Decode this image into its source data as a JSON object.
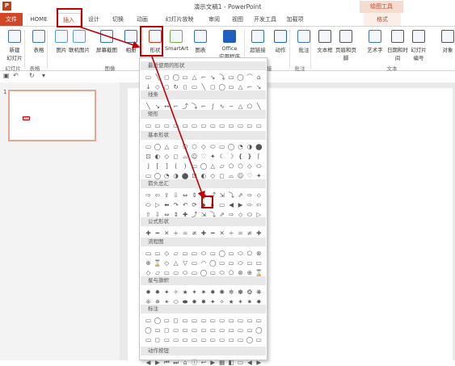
{
  "window": {
    "title": "演示文稿1 - PowerPoint",
    "context_tab_group": "绘图工具",
    "app_icon": "P"
  },
  "tabs": [
    "文件",
    "HOME",
    "插入",
    "设计",
    "切换",
    "动画",
    "幻灯片放映",
    "审阅",
    "视图",
    "开发工具",
    "加载项",
    "格式"
  ],
  "ribbon": {
    "buttons": [
      {
        "label": "新建\n幻灯片",
        "icon": "new-slide-icon"
      },
      {
        "label": "表格",
        "icon": "table-icon"
      },
      {
        "label": "图片",
        "icon": "picture-icon"
      },
      {
        "label": "联机图片",
        "icon": "online-picture-icon"
      },
      {
        "label": "屏幕截图",
        "icon": "screenshot-icon"
      },
      {
        "label": "相册",
        "icon": "album-icon"
      },
      {
        "label": "形状",
        "icon": "shapes-icon"
      },
      {
        "label": "SmartArt",
        "icon": "smartart-icon"
      },
      {
        "label": "图表",
        "icon": "chart-icon"
      },
      {
        "label": "Office\n应用程序",
        "icon": "office-store-icon"
      },
      {
        "label": "超链接",
        "icon": "hyperlink-icon"
      },
      {
        "label": "动作",
        "icon": "action-icon"
      },
      {
        "label": "批注",
        "icon": "comment-icon"
      },
      {
        "label": "文本框",
        "icon": "textbox-icon"
      },
      {
        "label": "页眉和页脚",
        "icon": "header-footer-icon"
      },
      {
        "label": "艺术字",
        "icon": "wordart-icon"
      },
      {
        "label": "日期和时间",
        "icon": "datetime-icon"
      },
      {
        "label": "幻灯片\n编号",
        "icon": "slide-number-icon"
      },
      {
        "label": "对象",
        "icon": "object-icon"
      }
    ],
    "groups": [
      "幻灯片",
      "表格",
      "图像",
      "链接",
      "批注",
      "文本"
    ]
  },
  "quick_access": [
    "save-icon",
    "undo-icon",
    "redo-icon",
    "customize-icon"
  ],
  "thumbnails": {
    "slide_number": "1"
  },
  "gallery": {
    "sections": [
      "最近使用的形状",
      "线条",
      "矩形",
      "基本形状",
      "箭头总汇",
      "公式形状",
      "流程图",
      "星与旗帜",
      "标注",
      "动作按钮"
    ],
    "glyphs": {
      "recent": "▭╲◻◯▭△⌐↘⤵▭◯⌒⌂↓◇○↻▯",
      "lines": "╲↘↔⌐⤴⤵⌐∫∿∽△⬠",
      "rect": "▭▭▭▭▭▭▭▭",
      "basic": "▭◯△▱⬠⬡◇⬭▭◯◔◑⬤⊡◐◇◻⌓☺♡✦☾☽❴❵⌈⌋[]()",
      "arrows": "⇨⇦⇧⇩⇔⇕✚⤴⇲⤵⇗⇨⬦⬭▷⬅↷↶⟳⬥▸▭◀▶",
      "equation": "✚━✕÷=≠",
      "flow": "▭▭◇▱▭▭⬭▭◯▭⬭⬠⊗⊕⌛◇△▽▭◠◯▭▭⬭",
      "stars": "✹✸✦✧★✶✷✸✺✼✽❂❋❊✵✴⬭⬬",
      "callouts": "▭◯▭◻▭▭▭▭▭▭▭▭",
      "action": "◀▶⏮⏭⌂ⓘ↩▶▦◧▭"
    }
  },
  "colors": {
    "accent": "#c43e1c",
    "highlight": "#c00000",
    "context": "#f5dccf"
  }
}
